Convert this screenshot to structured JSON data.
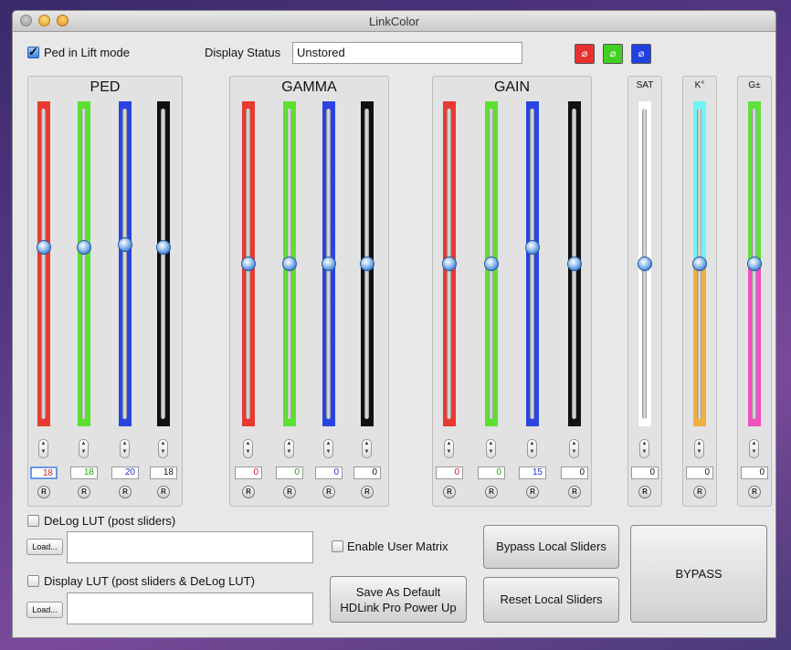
{
  "window": {
    "title": "LinkColor"
  },
  "top": {
    "ped_lift_label": "Ped in Lift mode",
    "display_status_label": "Display Status",
    "display_status_value": "Unstored",
    "color_buttons": [
      {
        "glyph": "⌀",
        "color": "#e83030"
      },
      {
        "glyph": "⌀",
        "color": "#40d020"
      },
      {
        "glyph": "⌀",
        "color": "#2040e0"
      }
    ]
  },
  "groups": {
    "ped": {
      "title": "PED",
      "values": [
        "18",
        "18",
        "20",
        "18"
      ],
      "value_colors": [
        "#d02020",
        "#30a020",
        "#2030d0",
        "#111111"
      ],
      "levels": [
        0.55,
        0.55,
        0.56,
        0.55
      ]
    },
    "gamma": {
      "title": "GAMMA",
      "values": [
        "0",
        "0",
        "0",
        "0"
      ],
      "value_colors": [
        "#d02020",
        "#30a020",
        "#2030d0",
        "#111111"
      ],
      "levels": [
        0.5,
        0.5,
        0.5,
        0.5
      ]
    },
    "gain": {
      "title": "GAIN",
      "values": [
        "0",
        "0",
        "15",
        "0"
      ],
      "value_colors": [
        "#d02020",
        "#30a020",
        "#2030d0",
        "#111111"
      ],
      "levels": [
        0.5,
        0.5,
        0.55,
        0.5
      ]
    },
    "sat": {
      "title": "SAT",
      "value": "0",
      "level": 0.5
    },
    "kelvin": {
      "title": "K°",
      "value": "0",
      "level": 0.5
    },
    "gpm": {
      "title": "G±",
      "value": "0",
      "level": 0.5
    }
  },
  "reset_label": "R",
  "channel_colors": [
    "#e83a30",
    "#5ce030",
    "#2a44e0",
    "#111111"
  ],
  "bottom": {
    "delog_label": "DeLog LUT (post sliders)",
    "load_label": "Load...",
    "display_lut_label": "Display LUT (post sliders & DeLog LUT)",
    "enable_matrix_label": "Enable User Matrix",
    "save_default_line1": "Save As Default",
    "save_default_line2": "HDLink Pro Power Up",
    "bypass_local_label": "Bypass Local Sliders",
    "reset_local_label": "Reset Local Sliders",
    "bypass_label": "BYPASS"
  }
}
